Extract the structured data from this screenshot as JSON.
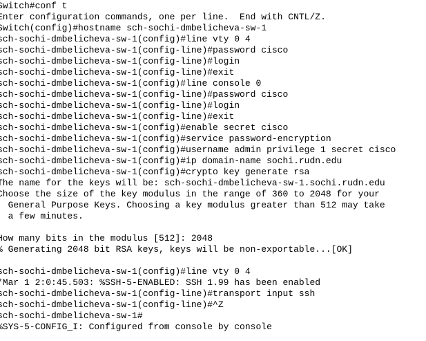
{
  "terminal": {
    "lines": [
      "Switch#conf t",
      "Enter configuration commands, one per line.  End with CNTL/Z.",
      "Switch(config)#hostname sch-sochi-dmbelicheva-sw-1",
      "sch-sochi-dmbelicheva-sw-1(config)#line vty 0 4",
      "sch-sochi-dmbelicheva-sw-1(config-line)#password cisco",
      "sch-sochi-dmbelicheva-sw-1(config-line)#login",
      "sch-sochi-dmbelicheva-sw-1(config-line)#exit",
      "sch-sochi-dmbelicheva-sw-1(config)#line console 0",
      "sch-sochi-dmbelicheva-sw-1(config-line)#password cisco",
      "sch-sochi-dmbelicheva-sw-1(config-line)#login",
      "sch-sochi-dmbelicheva-sw-1(config-line)#exit",
      "sch-sochi-dmbelicheva-sw-1(config)#enable secret cisco",
      "sch-sochi-dmbelicheva-sw-1(config)#service password-encryption",
      "sch-sochi-dmbelicheva-sw-1(config)#username admin privilege 1 secret cisco",
      "sch-sochi-dmbelicheva-sw-1(config)#ip domain-name sochi.rudn.edu",
      "sch-sochi-dmbelicheva-sw-1(config)#crypto key generate rsa",
      "The name for the keys will be: sch-sochi-dmbelicheva-sw-1.sochi.rudn.edu",
      "Choose the size of the key modulus in the range of 360 to 2048 for your",
      "  General Purpose Keys. Choosing a key modulus greater than 512 may take",
      "  a few minutes.",
      "",
      "How many bits in the modulus [512]: 2048",
      "% Generating 2048 bit RSA keys, keys will be non-exportable...[OK]",
      "",
      "sch-sochi-dmbelicheva-sw-1(config)#line vty 0 4",
      "*Mar 1 2:0:45.503: %SSH-5-ENABLED: SSH 1.99 has been enabled",
      "sch-sochi-dmbelicheva-sw-1(config-line)#transport input ssh",
      "sch-sochi-dmbelicheva-sw-1(config-line)#^Z",
      "sch-sochi-dmbelicheva-sw-1#",
      "%SYS-5-CONFIG_I: Configured from console by console"
    ]
  }
}
